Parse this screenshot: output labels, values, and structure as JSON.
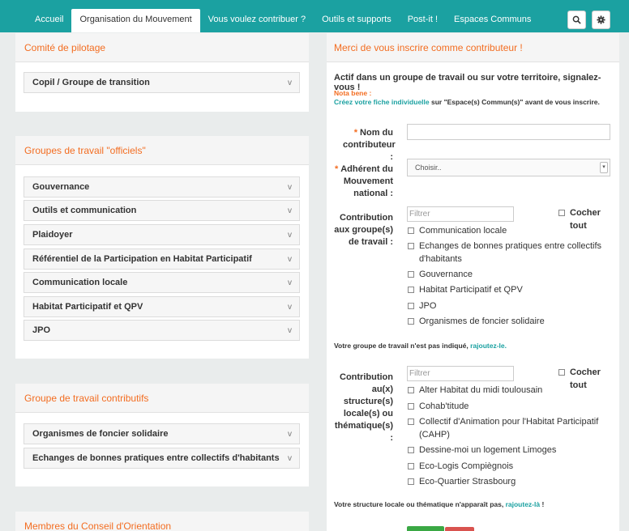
{
  "nav": {
    "tabs": [
      "Accueil",
      "Organisation du Mouvement",
      "Vous voulez contribuer ?",
      "Outils et supports",
      "Post-it !",
      "Espaces Communs"
    ],
    "active_index": 1,
    "search_icon": "search-icon",
    "settings_icon": "gear-icon"
  },
  "left": {
    "copil": {
      "title": "Comité de pilotage",
      "items": [
        "Copil / Groupe de transition"
      ]
    },
    "officiels": {
      "title": "Groupes de travail \"officiels\"",
      "items": [
        "Gouvernance",
        "Outils et communication",
        "Plaidoyer",
        "Référentiel de la Participation en Habitat Participatif",
        "Communication locale",
        "Habitat Participatif et QPV",
        "JPO"
      ]
    },
    "contributifs": {
      "title": "Groupe de travail contributifs",
      "items": [
        "Organismes de foncier solidaire",
        "Echanges de bonnes pratiques entre collectifs d'habitants"
      ]
    },
    "conseil": {
      "title": "Membres du Conseil d'Orientation"
    },
    "chevron": "v"
  },
  "form": {
    "title": "Merci de vous inscrire comme contributeur !",
    "intro": "Actif dans un groupe de travail ou sur votre territoire, signalez-vous !",
    "nota_label": "Nota bene :",
    "nota_link": "Créez votre fiche individuelle",
    "nota_rest": " sur \"Espace(s) Commun(s)\" avant de vous inscrire.",
    "required_mark": "*",
    "name_label": [
      "Nom du",
      "contributeur :"
    ],
    "adherent_label": [
      "Adhérent du",
      "Mouvement",
      "national :"
    ],
    "adherent_select": "Choisir..",
    "groups_label": [
      "Contribution",
      "aux groupe(s)",
      "de travail :"
    ],
    "groups_filter_placeholder": "Filtrer",
    "check_all": "Cocher tout",
    "groups": [
      "Communication locale",
      "Echanges de bonnes pratiques entre collectifs d'habitants",
      "Gouvernance",
      "Habitat Participatif et QPV",
      "JPO",
      "Organismes de foncier solidaire"
    ],
    "groups_missing_text": "Votre groupe de travail n'est pas indiqué, ",
    "groups_missing_link": "rajoutez-le.",
    "structures_label": [
      "Contribution",
      "au(x)",
      "structure(s)",
      "locale(s) ou",
      "thématique(s)",
      ":"
    ],
    "structures_filter_placeholder": "Filtrer",
    "structures": [
      "Alter Habitat du midi toulousain",
      "Cohab'titude",
      "Collectif d'Animation pour l'Habitat Participatif (CAHP)",
      "Dessine-moi un logement Limoges",
      "Eco-Logis Compiègnois",
      "Eco-Quartier Strasbourg"
    ],
    "structures_missing_text": "Votre structure locale ou thématique n'apparaît pas, ",
    "structures_missing_link": "rajoutez-là",
    "structures_missing_end": " !",
    "colors": {
      "accent": "#f36d21",
      "teal": "#1ba1a1",
      "submit": "#3aa844",
      "cancel": "#d9534f"
    }
  }
}
